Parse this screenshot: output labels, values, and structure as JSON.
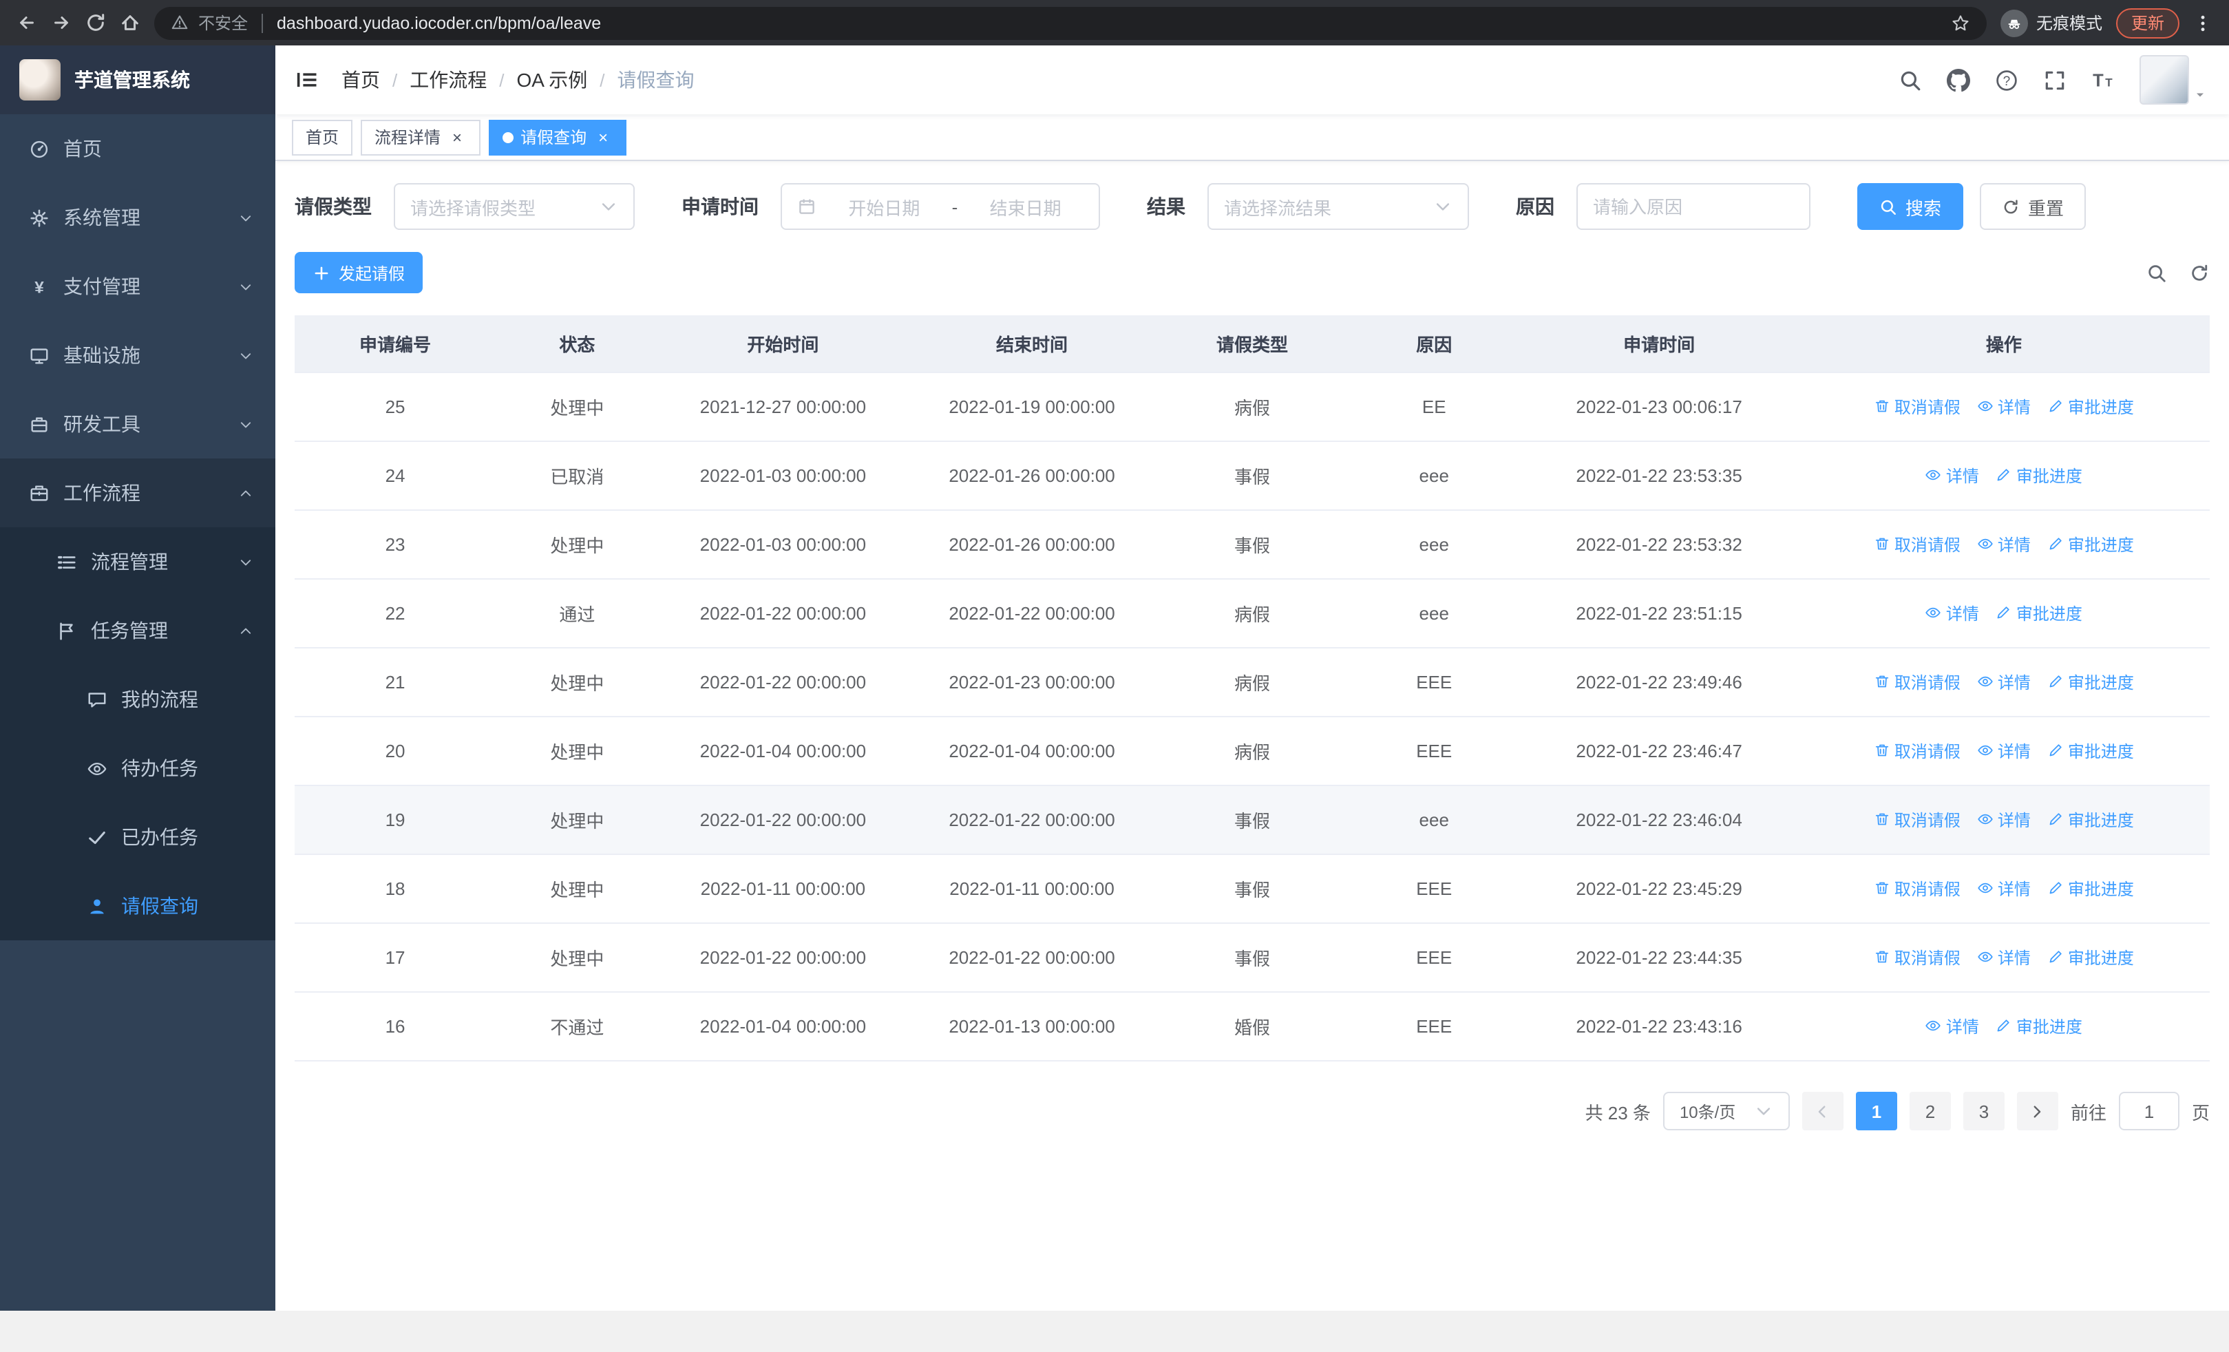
{
  "colors": {
    "accent": "#409eff",
    "sidebar_bg": "#304156",
    "sidebar_submenu_bg": "#1f2d3d",
    "sidebar_text": "#bfcbd9",
    "browser_bg": "#2f3136",
    "urlbar_bg": "#202124",
    "update_accent": "#ff8a74",
    "table_header_bg": "#eef1f6"
  },
  "browser": {
    "security_label": "不安全",
    "url": "dashboard.yudao.iocoder.cn/bpm/oa/leave",
    "incognito_label": "无痕模式",
    "update_label": "更新"
  },
  "sidebar": {
    "title": "芋道管理系统",
    "items": [
      {
        "key": "home",
        "label": "首页",
        "icon": "dashboard-icon",
        "level": 1,
        "expandable": false
      },
      {
        "key": "system",
        "label": "系统管理",
        "icon": "gear-icon",
        "level": 1,
        "expandable": true,
        "expanded": false
      },
      {
        "key": "payment",
        "label": "支付管理",
        "icon": "yen-icon",
        "level": 1,
        "expandable": true,
        "expanded": false
      },
      {
        "key": "infrastructure",
        "label": "基础设施",
        "icon": "monitor-icon",
        "level": 1,
        "expandable": true,
        "expanded": false
      },
      {
        "key": "devtools",
        "label": "研发工具",
        "icon": "toolbox-icon",
        "level": 1,
        "expandable": true,
        "expanded": false
      },
      {
        "key": "workflow",
        "label": "工作流程",
        "icon": "briefcase-icon",
        "level": 1,
        "expandable": true,
        "expanded": true,
        "open": true
      },
      {
        "key": "process-manage",
        "label": "流程管理",
        "icon": "list-icon",
        "level": 2,
        "expandable": true,
        "expanded": false
      },
      {
        "key": "task-manage",
        "label": "任务管理",
        "icon": "flag-icon",
        "level": 2,
        "expandable": true,
        "expanded": true
      },
      {
        "key": "my-process",
        "label": "我的流程",
        "icon": "chat-icon",
        "level": 3,
        "expandable": false
      },
      {
        "key": "todo-task",
        "label": "待办任务",
        "icon": "eye-icon",
        "level": 3,
        "expandable": false
      },
      {
        "key": "done-task",
        "label": "已办任务",
        "icon": "check-icon",
        "level": 3,
        "expandable": false
      },
      {
        "key": "leave-query",
        "label": "请假查询",
        "icon": "user-icon",
        "level": 3,
        "expandable": false,
        "active": true
      }
    ]
  },
  "breadcrumb": [
    "首页",
    "工作流程",
    "OA 示例",
    "请假查询"
  ],
  "tabs": [
    {
      "key": "home",
      "label": "首页",
      "closable": false,
      "active": false
    },
    {
      "key": "process-detail",
      "label": "流程详情",
      "closable": true,
      "active": false
    },
    {
      "key": "leave-query",
      "label": "请假查询",
      "closable": true,
      "active": true
    }
  ],
  "filters": {
    "leave_type_label": "请假类型",
    "leave_type_placeholder": "请选择请假类型",
    "apply_time_label": "申请时间",
    "start_date_placeholder": "开始日期",
    "range_separator": "-",
    "end_date_placeholder": "结束日期",
    "result_label": "结果",
    "result_placeholder": "请选择流结果",
    "reason_label": "原因",
    "reason_placeholder": "请输入原因",
    "search_label": "搜索",
    "reset_label": "重置"
  },
  "toolbar": {
    "create_label": "发起请假"
  },
  "table": {
    "columns": [
      "申请编号",
      "状态",
      "开始时间",
      "结束时间",
      "请假类型",
      "原因",
      "申请时间",
      "操作"
    ],
    "op_labels": {
      "cancel": "取消请假",
      "detail": "详情",
      "progress": "审批进度"
    },
    "rows": [
      {
        "id": "25",
        "status": "处理中",
        "start": "2021-12-27 00:00:00",
        "end": "2022-01-19 00:00:00",
        "type": "病假",
        "reason": "EE",
        "applied": "2022-01-23 00:06:17",
        "ops": [
          "cancel",
          "detail",
          "progress"
        ]
      },
      {
        "id": "24",
        "status": "已取消",
        "start": "2022-01-03 00:00:00",
        "end": "2022-01-26 00:00:00",
        "type": "事假",
        "reason": "eee",
        "applied": "2022-01-22 23:53:35",
        "ops": [
          "detail",
          "progress"
        ]
      },
      {
        "id": "23",
        "status": "处理中",
        "start": "2022-01-03 00:00:00",
        "end": "2022-01-26 00:00:00",
        "type": "事假",
        "reason": "eee",
        "applied": "2022-01-22 23:53:32",
        "ops": [
          "cancel",
          "detail",
          "progress"
        ]
      },
      {
        "id": "22",
        "status": "通过",
        "start": "2022-01-22 00:00:00",
        "end": "2022-01-22 00:00:00",
        "type": "病假",
        "reason": "eee",
        "applied": "2022-01-22 23:51:15",
        "ops": [
          "detail",
          "progress"
        ]
      },
      {
        "id": "21",
        "status": "处理中",
        "start": "2022-01-22 00:00:00",
        "end": "2022-01-23 00:00:00",
        "type": "病假",
        "reason": "EEE",
        "applied": "2022-01-22 23:49:46",
        "ops": [
          "cancel",
          "detail",
          "progress"
        ]
      },
      {
        "id": "20",
        "status": "处理中",
        "start": "2022-01-04 00:00:00",
        "end": "2022-01-04 00:00:00",
        "type": "病假",
        "reason": "EEE",
        "applied": "2022-01-22 23:46:47",
        "ops": [
          "cancel",
          "detail",
          "progress"
        ]
      },
      {
        "id": "19",
        "status": "处理中",
        "start": "2022-01-22 00:00:00",
        "end": "2022-01-22 00:00:00",
        "type": "事假",
        "reason": "eee",
        "applied": "2022-01-22 23:46:04",
        "ops": [
          "cancel",
          "detail",
          "progress"
        ],
        "highlight": true
      },
      {
        "id": "18",
        "status": "处理中",
        "start": "2022-01-11 00:00:00",
        "end": "2022-01-11 00:00:00",
        "type": "事假",
        "reason": "EEE",
        "applied": "2022-01-22 23:45:29",
        "ops": [
          "cancel",
          "detail",
          "progress"
        ]
      },
      {
        "id": "17",
        "status": "处理中",
        "start": "2022-01-22 00:00:00",
        "end": "2022-01-22 00:00:00",
        "type": "事假",
        "reason": "EEE",
        "applied": "2022-01-22 23:44:35",
        "ops": [
          "cancel",
          "detail",
          "progress"
        ]
      },
      {
        "id": "16",
        "status": "不通过",
        "start": "2022-01-04 00:00:00",
        "end": "2022-01-13 00:00:00",
        "type": "婚假",
        "reason": "EEE",
        "applied": "2022-01-22 23:43:16",
        "ops": [
          "detail",
          "progress"
        ]
      }
    ]
  },
  "pagination": {
    "total_label": "共 23 条",
    "page_size": "10条/页",
    "pages": [
      "1",
      "2",
      "3"
    ],
    "active_page": "1",
    "goto_label": "前往",
    "goto_value": "1",
    "goto_unit": "页"
  }
}
